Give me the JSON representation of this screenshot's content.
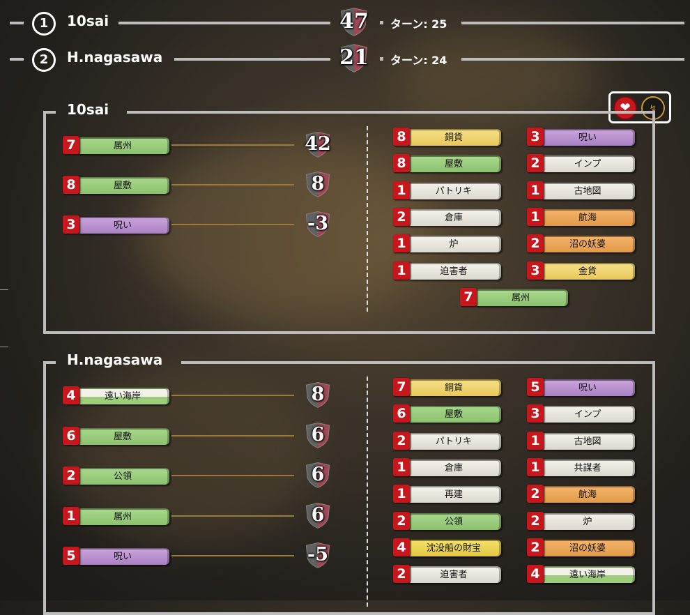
{
  "scoreboard": [
    {
      "rank": "1",
      "name": "10sai",
      "vp": "47",
      "turns": "ターン: 25"
    },
    {
      "rank": "2",
      "name": "H.nagasawa",
      "vp": "21",
      "turns": "ターン: 24"
    }
  ],
  "toggles": {
    "heart": "heart-icon",
    "bolt": "lightning-icon",
    "heart_color": "#c8161d",
    "bolt_color": "#c89a3a"
  },
  "players": [
    {
      "name": "10sai",
      "vp_cards": [
        {
          "count": "7",
          "name": "属州",
          "color": "green",
          "vp": "42"
        },
        {
          "count": "8",
          "name": "屋敷",
          "color": "green",
          "vp": "8"
        },
        {
          "count": "3",
          "name": "呪い",
          "color": "purple",
          "vp": "-3"
        }
      ],
      "deck_left": [
        {
          "count": "8",
          "name": "銅貨",
          "color": "yellow"
        },
        {
          "count": "8",
          "name": "屋敷",
          "color": "green"
        },
        {
          "count": "1",
          "name": "パトリキ",
          "color": "white"
        },
        {
          "count": "2",
          "name": "倉庫",
          "color": "white"
        },
        {
          "count": "1",
          "name": "炉",
          "color": "white"
        },
        {
          "count": "1",
          "name": "迫害者",
          "color": "white"
        }
      ],
      "deck_right": [
        {
          "count": "3",
          "name": "呪い",
          "color": "purple"
        },
        {
          "count": "2",
          "name": "インプ",
          "color": "white"
        },
        {
          "count": "1",
          "name": "古地図",
          "color": "white"
        },
        {
          "count": "1",
          "name": "航海",
          "color": "orange"
        },
        {
          "count": "2",
          "name": "沼の妖婆",
          "color": "orange"
        },
        {
          "count": "3",
          "name": "金貨",
          "color": "yellow"
        }
      ],
      "deck_center": [
        {
          "count": "7",
          "name": "属州",
          "color": "green"
        }
      ]
    },
    {
      "name": "H.nagasawa",
      "vp_cards": [
        {
          "count": "4",
          "name": "遠い海岸",
          "color": "split",
          "vp": "8"
        },
        {
          "count": "6",
          "name": "屋敷",
          "color": "green",
          "vp": "6"
        },
        {
          "count": "2",
          "name": "公領",
          "color": "green",
          "vp": "6"
        },
        {
          "count": "1",
          "name": "属州",
          "color": "green",
          "vp": "6"
        },
        {
          "count": "5",
          "name": "呪い",
          "color": "purple",
          "vp": "-5"
        }
      ],
      "deck_left": [
        {
          "count": "7",
          "name": "銅貨",
          "color": "yellow"
        },
        {
          "count": "6",
          "name": "屋敷",
          "color": "green"
        },
        {
          "count": "2",
          "name": "パトリキ",
          "color": "white"
        },
        {
          "count": "1",
          "name": "倉庫",
          "color": "white"
        },
        {
          "count": "1",
          "name": "再建",
          "color": "white"
        },
        {
          "count": "2",
          "name": "公領",
          "color": "green"
        },
        {
          "count": "4",
          "name": "沈没船の財宝",
          "color": "treasure"
        },
        {
          "count": "2",
          "name": "迫害者",
          "color": "white"
        }
      ],
      "deck_right": [
        {
          "count": "5",
          "name": "呪い",
          "color": "purple"
        },
        {
          "count": "3",
          "name": "インプ",
          "color": "white"
        },
        {
          "count": "1",
          "name": "古地図",
          "color": "white"
        },
        {
          "count": "1",
          "name": "共謀者",
          "color": "white"
        },
        {
          "count": "2",
          "name": "航海",
          "color": "orange"
        },
        {
          "count": "2",
          "name": "炉",
          "color": "white"
        },
        {
          "count": "2",
          "name": "沼の妖婆",
          "color": "orange"
        },
        {
          "count": "4",
          "name": "遠い海岸",
          "color": "split"
        }
      ],
      "deck_center": []
    }
  ]
}
